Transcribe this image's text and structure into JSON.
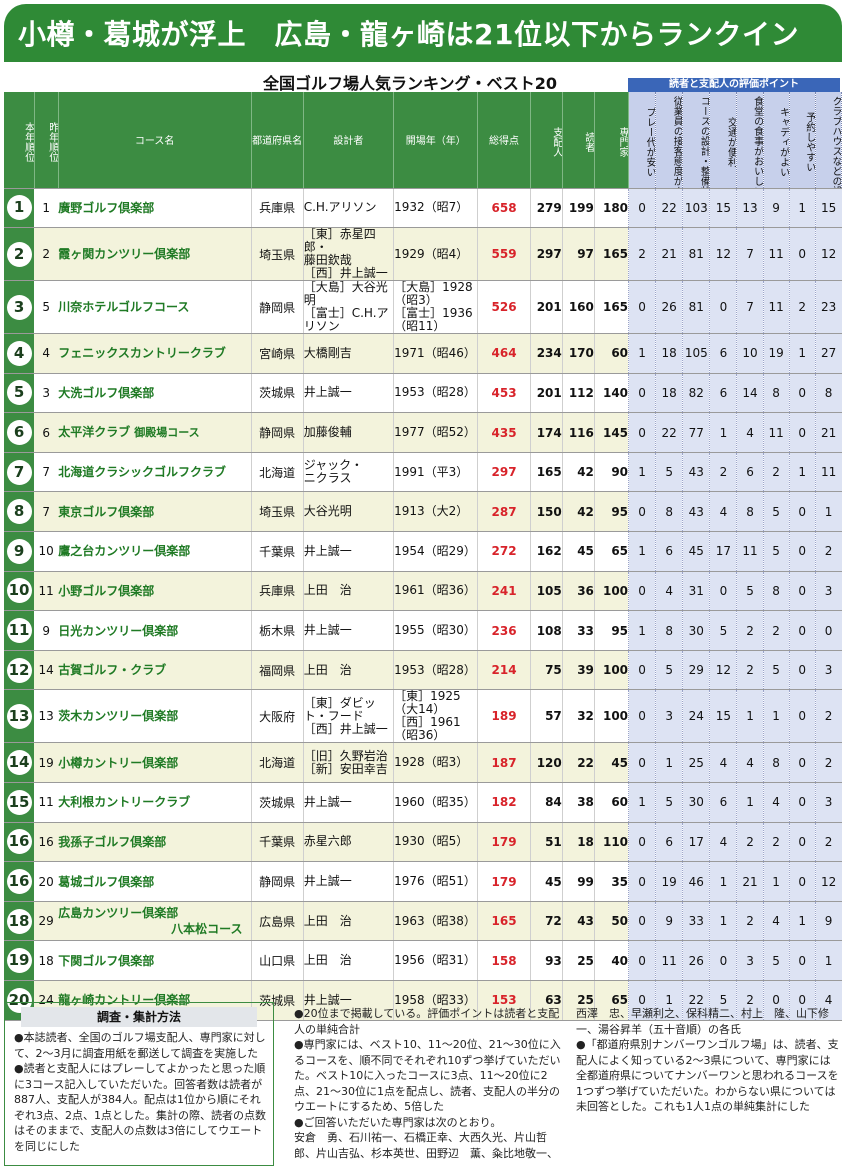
{
  "headline": "小樽・葛城が浮上　広島・龍ヶ崎は21位以下からランクイン",
  "subtitle": "全国ゴルフ場人気ランキング・ベスト20",
  "eval_header": "読者と支配人の評価ポイント",
  "columns": {
    "rank": "本年順位",
    "prev": "昨年順位",
    "name": "コース名",
    "pref": "都道府県名",
    "designer": "設計者",
    "year": "開場年（年）",
    "total": "総得点",
    "manager": "支配人",
    "reader": "読者",
    "expert": "専門家",
    "eval": [
      "プレー代が安い",
      "従業員の接客態度がよい",
      "コースの設計・整備状況がよい",
      "交通が便利",
      "食堂の食事がおいしい、安い、メニュー豊富",
      "キャディがよい",
      "予約しやすい",
      "クラブハウスなどの設備がよい"
    ]
  },
  "rows": [
    {
      "rank": "1",
      "prev": "1",
      "name": "廣野ゴルフ倶楽部",
      "sub": "",
      "pref": "兵庫県",
      "designer": "C.H.アリソン",
      "year": "1932（昭7）",
      "total": "658",
      "manager": "279",
      "reader": "199",
      "expert": "180",
      "ev": [
        "0",
        "22",
        "103",
        "15",
        "13",
        "9",
        "1",
        "15"
      ]
    },
    {
      "rank": "2",
      "prev": "2",
      "name": "霞ヶ関カンツリー倶楽部",
      "sub": "",
      "pref": "埼玉県",
      "designer": "［東］赤星四郎・\n藤田欽哉\n［西］井上誠一",
      "year": "1929（昭4）",
      "total": "559",
      "manager": "297",
      "reader": "97",
      "expert": "165",
      "ev": [
        "2",
        "21",
        "81",
        "12",
        "7",
        "11",
        "0",
        "12"
      ]
    },
    {
      "rank": "3",
      "prev": "5",
      "name": "川奈ホテルゴルフコース",
      "sub": "",
      "pref": "静岡県",
      "designer": "［大島］大谷光明\n［富士］C.H.アリソン",
      "year": "［大島］1928（昭3）\n［富士］1936（昭11）",
      "total": "526",
      "manager": "201",
      "reader": "160",
      "expert": "165",
      "ev": [
        "0",
        "26",
        "81",
        "0",
        "7",
        "11",
        "2",
        "23"
      ]
    },
    {
      "rank": "4",
      "prev": "4",
      "name": "フェニックスカントリークラブ",
      "sub": "",
      "pref": "宮崎県",
      "designer": "大橋剛吉",
      "year": "1971（昭46）",
      "total": "464",
      "manager": "234",
      "reader": "170",
      "expert": "60",
      "ev": [
        "1",
        "18",
        "105",
        "6",
        "10",
        "19",
        "1",
        "27"
      ]
    },
    {
      "rank": "5",
      "prev": "3",
      "name": "大洗ゴルフ倶楽部",
      "sub": "",
      "pref": "茨城県",
      "designer": "井上誠一",
      "year": "1953（昭28）",
      "total": "453",
      "manager": "201",
      "reader": "112",
      "expert": "140",
      "ev": [
        "0",
        "18",
        "82",
        "6",
        "14",
        "8",
        "0",
        "8"
      ]
    },
    {
      "rank": "6",
      "prev": "6",
      "name": "太平洋クラブ",
      "sub": "御殿場コース",
      "pref": "静岡県",
      "designer": "加藤俊輔",
      "year": "1977（昭52）",
      "total": "435",
      "manager": "174",
      "reader": "116",
      "expert": "145",
      "ev": [
        "0",
        "22",
        "77",
        "1",
        "4",
        "11",
        "0",
        "21"
      ]
    },
    {
      "rank": "7",
      "prev": "7",
      "name": "北海道クラシックゴルフクラブ",
      "sub": "",
      "pref": "北海道",
      "designer": "ジャック・\nニクラス",
      "year": "1991（平3）",
      "total": "297",
      "manager": "165",
      "reader": "42",
      "expert": "90",
      "ev": [
        "1",
        "5",
        "43",
        "2",
        "6",
        "2",
        "1",
        "11"
      ]
    },
    {
      "rank": "8",
      "prev": "7",
      "name": "東京ゴルフ倶楽部",
      "sub": "",
      "pref": "埼玉県",
      "designer": "大谷光明",
      "year": "1913（大2）",
      "total": "287",
      "manager": "150",
      "reader": "42",
      "expert": "95",
      "ev": [
        "0",
        "8",
        "43",
        "4",
        "8",
        "5",
        "0",
        "1"
      ]
    },
    {
      "rank": "9",
      "prev": "10",
      "name": "鷹之台カンツリー倶楽部",
      "sub": "",
      "pref": "千葉県",
      "designer": "井上誠一",
      "year": "1954（昭29）",
      "total": "272",
      "manager": "162",
      "reader": "45",
      "expert": "65",
      "ev": [
        "1",
        "6",
        "45",
        "17",
        "11",
        "5",
        "0",
        "2"
      ]
    },
    {
      "rank": "10",
      "prev": "11",
      "name": "小野ゴルフ倶楽部",
      "sub": "",
      "pref": "兵庫県",
      "designer": "上田　治",
      "year": "1961（昭36）",
      "total": "241",
      "manager": "105",
      "reader": "36",
      "expert": "100",
      "ev": [
        "0",
        "4",
        "31",
        "0",
        "5",
        "8",
        "0",
        "3"
      ]
    },
    {
      "rank": "11",
      "prev": "9",
      "name": "日光カンツリー倶楽部",
      "sub": "",
      "pref": "栃木県",
      "designer": "井上誠一",
      "year": "1955（昭30）",
      "total": "236",
      "manager": "108",
      "reader": "33",
      "expert": "95",
      "ev": [
        "1",
        "8",
        "30",
        "5",
        "2",
        "2",
        "0",
        "0"
      ]
    },
    {
      "rank": "12",
      "prev": "14",
      "name": "古賀ゴルフ・クラブ",
      "sub": "",
      "pref": "福岡県",
      "designer": "上田　治",
      "year": "1953（昭28）",
      "total": "214",
      "manager": "75",
      "reader": "39",
      "expert": "100",
      "ev": [
        "0",
        "5",
        "29",
        "12",
        "2",
        "5",
        "0",
        "3"
      ]
    },
    {
      "rank": "13",
      "prev": "13",
      "name": "茨木カンツリー倶楽部",
      "sub": "",
      "pref": "大阪府",
      "designer": "［東］ダビット・フード\n［西］井上誠一",
      "year": "［東］1925（大14）\n［西］1961（昭36）",
      "total": "189",
      "manager": "57",
      "reader": "32",
      "expert": "100",
      "ev": [
        "0",
        "3",
        "24",
        "15",
        "1",
        "1",
        "0",
        "2"
      ]
    },
    {
      "rank": "14",
      "prev": "19",
      "name": "小樽カントリー倶楽部",
      "sub": "",
      "pref": "北海道",
      "designer": "［旧］久野岩治\n［新］安田幸吉",
      "year": "1928（昭3）",
      "total": "187",
      "manager": "120",
      "reader": "22",
      "expert": "45",
      "ev": [
        "0",
        "1",
        "25",
        "4",
        "4",
        "8",
        "0",
        "2"
      ]
    },
    {
      "rank": "15",
      "prev": "11",
      "name": "大利根カントリークラブ",
      "sub": "",
      "pref": "茨城県",
      "designer": "井上誠一",
      "year": "1960（昭35）",
      "total": "182",
      "manager": "84",
      "reader": "38",
      "expert": "60",
      "ev": [
        "1",
        "5",
        "30",
        "6",
        "1",
        "4",
        "0",
        "3"
      ]
    },
    {
      "rank": "16",
      "prev": "16",
      "name": "我孫子ゴルフ倶楽部",
      "sub": "",
      "pref": "千葉県",
      "designer": "赤星六郎",
      "year": "1930（昭5）",
      "total": "179",
      "manager": "51",
      "reader": "18",
      "expert": "110",
      "ev": [
        "0",
        "6",
        "17",
        "4",
        "2",
        "2",
        "0",
        "2"
      ]
    },
    {
      "rank": "16",
      "prev": "20",
      "name": "葛城ゴルフ倶楽部",
      "sub": "",
      "pref": "静岡県",
      "designer": "井上誠一",
      "year": "1976（昭51）",
      "total": "179",
      "manager": "45",
      "reader": "99",
      "expert": "35",
      "ev": [
        "0",
        "19",
        "46",
        "1",
        "21",
        "1",
        "0",
        "12"
      ]
    },
    {
      "rank": "18",
      "prev": "29",
      "name": "広島カンツリー倶楽部",
      "sub2": "八本松コース",
      "pref": "広島県",
      "designer": "上田　治",
      "year": "1963（昭38）",
      "total": "165",
      "manager": "72",
      "reader": "43",
      "expert": "50",
      "ev": [
        "0",
        "9",
        "33",
        "1",
        "2",
        "4",
        "1",
        "9"
      ]
    },
    {
      "rank": "19",
      "prev": "18",
      "name": "下関ゴルフ倶楽部",
      "sub": "",
      "pref": "山口県",
      "designer": "上田　治",
      "year": "1956（昭31）",
      "total": "158",
      "manager": "93",
      "reader": "25",
      "expert": "40",
      "ev": [
        "0",
        "11",
        "26",
        "0",
        "3",
        "5",
        "0",
        "1"
      ]
    },
    {
      "rank": "20",
      "prev": "24",
      "name": "龍ヶ崎カントリー倶楽部",
      "sub": "",
      "pref": "茨城県",
      "designer": "井上誠一",
      "year": "1958（昭33）",
      "total": "153",
      "manager": "63",
      "reader": "25",
      "expert": "65",
      "ev": [
        "0",
        "1",
        "22",
        "5",
        "2",
        "0",
        "0",
        "4"
      ]
    }
  ],
  "notes": {
    "method_title": "調査・集計方法",
    "col1": "●本誌読者、全国のゴルフ場支配人、専門家に対して、2～3月に調査用紙を郵送して調査を実施した\n●読者と支配人にはプレーしてよかったと思った順に3コース記入していただいた。回答者数は読者が887人、支配人が384人。配点は1位から順にそれぞれ3点、2点、1点とした。集計の際、読者の点数はそのままで、支配人の点数は3倍にしてウエートを同じにした",
    "col2": "●20位まで掲載している。評価ポイントは読者と支配人の単純合計\n●専門家には、ベスト10、11～20位、21～30位に入るコースを、順不同でそれぞれ10ずつ挙げていただいた。ベスト10に入ったコースに3点、11～20位に2点、21～30位に1点を配点し、読者、支配人の半分のウエートにするため、5倍した\n●ご回答いただいた専門家は次のとおり。\n安倉　勇、石川祐一、石橋正幸、大西久光、片山哲郎、片山吉弘、杉本英世、田野辺　薫、粂比地敬一、",
    "col3": "西澤　忠、早瀬利之、保科精二、村上　隆、山下修一、湯谷昇羊（五十音順）の各氏\n●「都道府県別ナンバーワンゴルフ場」は、読者、支配人によく知っている2～3県について、専門家には全都道府県についてナンバーワンと思われるコースを1つずつ挙げていただいた。わからない県については未回答とした。これも1人1点の単純集計にした"
  }
}
